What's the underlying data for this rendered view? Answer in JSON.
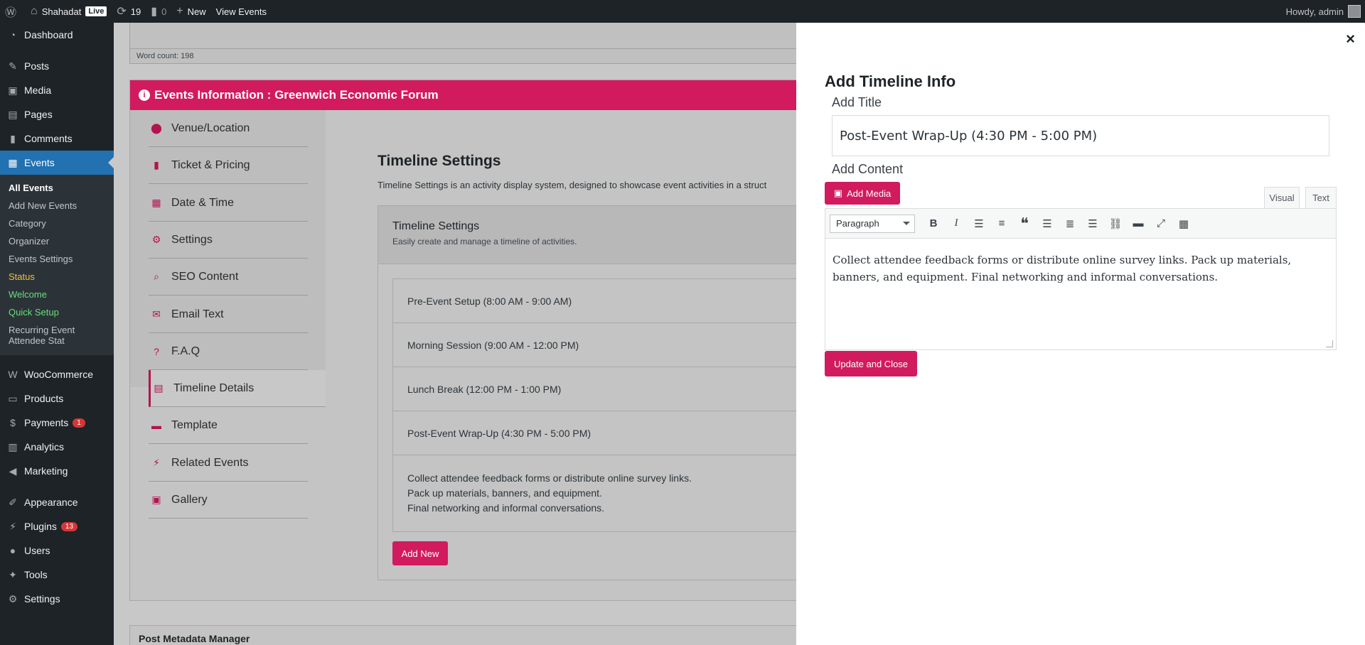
{
  "adminbar": {
    "site_name": "Shahadat",
    "live_badge": "Live",
    "updates_count": "19",
    "comments_count": "0",
    "new_label": "New",
    "view_events_label": "View Events",
    "howdy": "Howdy, admin"
  },
  "sidebar": {
    "dashboard": "Dashboard",
    "posts": "Posts",
    "media": "Media",
    "pages": "Pages",
    "comments": "Comments",
    "events": "Events",
    "events_sub": [
      "All Events",
      "Add New Events",
      "Category",
      "Organizer",
      "Events Settings",
      "Status",
      "Welcome",
      "Quick Setup",
      "Recurring Event Attendee Stat"
    ],
    "woocommerce": "WooCommerce",
    "products": "Products",
    "payments": "Payments",
    "payments_count": "1",
    "analytics": "Analytics",
    "marketing": "Marketing",
    "appearance": "Appearance",
    "plugins": "Plugins",
    "plugins_count": "13",
    "users": "Users",
    "tools": "Tools",
    "settings": "Settings"
  },
  "main": {
    "word_count": "Word count: 198",
    "events_header": "Events Information : Greenwich Economic Forum",
    "tabs": [
      "Venue/Location",
      "Ticket & Pricing",
      "Date & Time",
      "Settings",
      "SEO Content",
      "Email Text",
      "F.A.Q",
      "Timeline Details",
      "Template",
      "Related Events",
      "Gallery"
    ],
    "timeline_title": "Timeline Settings",
    "timeline_desc": "Timeline Settings is an activity display system, designed to showcase event activities in a struct",
    "card_title": "Timeline Settings",
    "card_subtitle": "Easily create and manage a timeline of activities.",
    "items": [
      "Pre-Event Setup (8:00 AM - 9:00 AM)",
      "Morning Session (9:00 AM - 12:00 PM)",
      "Lunch Break (12:00 PM - 1:00 PM)",
      "Post-Event Wrap-Up (4:30 PM - 5:00 PM)"
    ],
    "expanded_lines": [
      "Collect attendee feedback forms or distribute online survey links.",
      "Pack up materials, banners, and equipment.",
      "Final networking and informal conversations."
    ],
    "add_new": "Add New",
    "post_metadata": "Post Metadata Manager"
  },
  "panel": {
    "close": "×",
    "title": "Add Timeline Info",
    "add_title_label": "Add Title",
    "title_value": "Post-Event Wrap-Up (4:30 PM - 5:00 PM)",
    "add_content_label": "Add Content",
    "add_media": "Add Media",
    "tab_visual": "Visual",
    "tab_text": "Text",
    "format_select": "Paragraph",
    "content_text": "Collect attendee feedback forms or distribute online survey links. Pack up materials, banners, and equipment. Final networking and informal conversations.",
    "update_close": "Update and Close"
  }
}
